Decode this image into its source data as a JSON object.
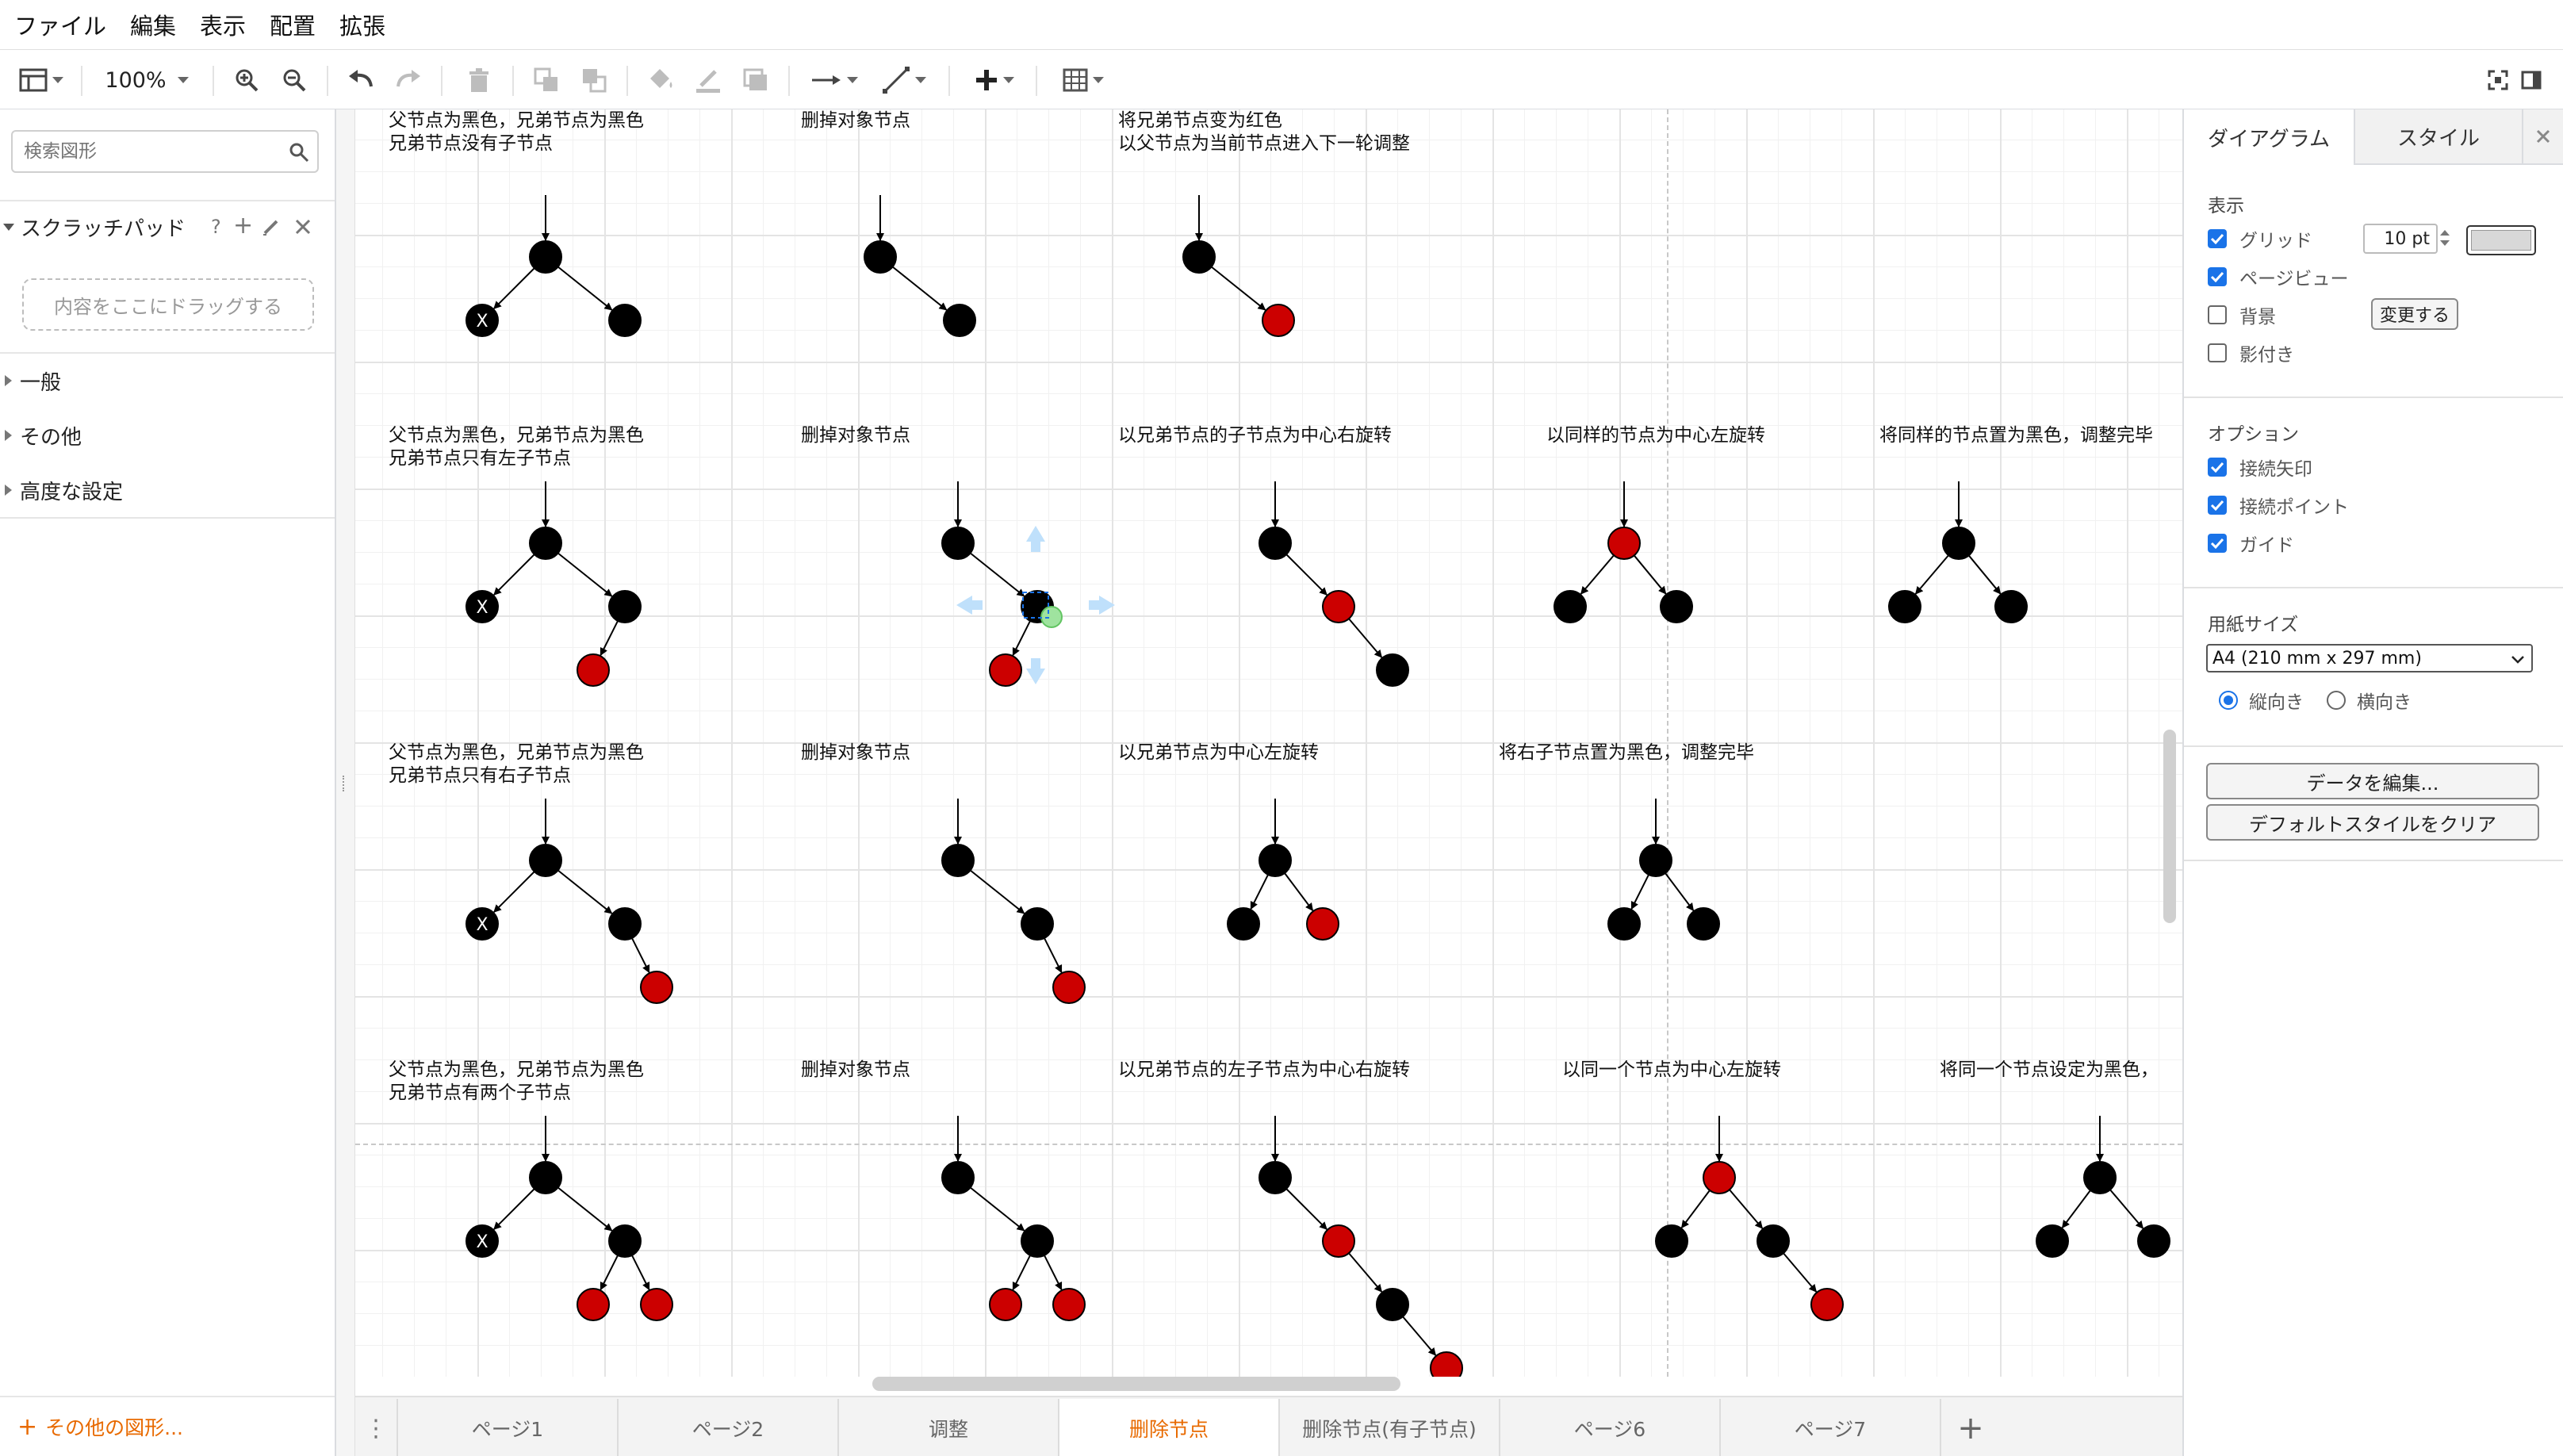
{
  "menubar": {
    "items": [
      "ファイル",
      "編集",
      "表示",
      "配置",
      "拡張"
    ]
  },
  "toolbar": {
    "zoom": "100%"
  },
  "left_panel": {
    "search_placeholder": "検索図形",
    "scratchpad": {
      "title": "スクラッチパッド",
      "help": "?",
      "dropzone": "内容をここにドラッグする"
    },
    "sections": [
      "一般",
      "その他",
      "高度な設定"
    ],
    "more_shapes": "その他の図形..."
  },
  "canvas": {
    "labels": [
      "父节点为黑色，兄弟节点为黑色\n兄弟节点没有子节点",
      "删掉对象节点",
      "将兄弟节点变为红色\n以父节点为当前节点进入下一轮调整",
      "父节点为黑色，兄弟节点为黑色\n兄弟节点只有左子节点",
      "删掉对象节点",
      "以兄弟节点的子节点为中心右旋转",
      "以同样的节点为中心左旋转",
      "将同样的节点置为黑色，调整完毕",
      "父节点为黑色，兄弟节点为黑色\n兄弟节点只有右子节点",
      "删掉对象节点",
      "以兄弟节点为中心左旋转",
      "将右子节点置为黑色，调整完毕",
      "父节点为黑色，兄弟节点为黑色\n兄弟节点有两个子节点",
      "删掉对象节点",
      "以兄弟节点的左子节点为中心右旋转",
      "以同一个节点为中心左旋转",
      "将同一个节点设定为黑色，"
    ],
    "x_mark": "X",
    "node_colors": {
      "black": "#000000",
      "red": "#cc0000"
    }
  },
  "right_panel": {
    "tabs": [
      "ダイアグラム",
      "スタイル"
    ],
    "display": {
      "title": "表示",
      "grid": "グリッド",
      "grid_size": "10 pt",
      "page_view": "ページビュー",
      "background": "背景",
      "change": "変更する",
      "shadow": "影付き"
    },
    "options": {
      "title": "オプション",
      "items": [
        "接続矢印",
        "接続ポイント",
        "ガイド"
      ]
    },
    "paper": {
      "title": "用紙サイズ",
      "size": "A4 (210 mm x 297 mm)",
      "portrait": "縦向き",
      "landscape": "横向き"
    },
    "edit_data": "データを編集...",
    "clear_style": "デフォルトスタイルをクリア"
  },
  "page_tabs": [
    "ページ1",
    "ページ2",
    "调整",
    "删除节点",
    "删除节点(有子节点)",
    "ページ6",
    "ページ7"
  ],
  "active_tab": "删除节点",
  "accent_color": "#e86a00",
  "checkbox_color": "#1a73e8"
}
